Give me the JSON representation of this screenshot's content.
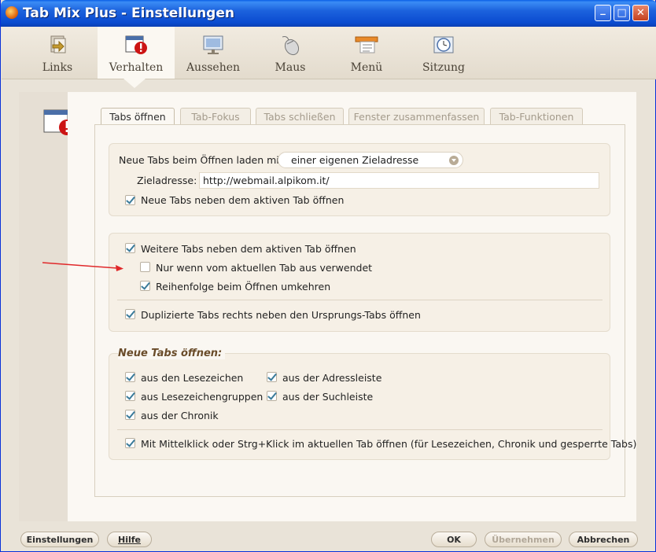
{
  "window": {
    "title": "Tab Mix Plus - Einstellungen"
  },
  "toolbar": {
    "items": [
      {
        "label": "Links",
        "icon": "links-icon"
      },
      {
        "label": "Verhalten",
        "icon": "behavior-icon",
        "active": true
      },
      {
        "label": "Aussehen",
        "icon": "appearance-icon"
      },
      {
        "label": "Maus",
        "icon": "mouse-icon"
      },
      {
        "label": "Menü",
        "icon": "menu-icon"
      },
      {
        "label": "Sitzung",
        "icon": "session-icon"
      }
    ]
  },
  "tabs": [
    "Tabs öffnen",
    "Tab-Fokus",
    "Tabs schließen",
    "Fenster zusammenfassen",
    "Tab-Funktionen"
  ],
  "group1": {
    "load_label": "Neue Tabs beim Öffnen laden mit",
    "load_value": "einer eigenen Zieladresse",
    "url_label": "Zieladresse:",
    "url_value": "http://webmail.alpikom.it/",
    "next_to_active": "Neue Tabs neben dem aktiven Tab öffnen"
  },
  "group2": {
    "further_tabs": "Weitere Tabs neben dem aktiven Tab öffnen",
    "only_if_used": "Nur wenn vom aktuellen Tab aus verwendet",
    "reverse_order": "Reihenfolge beim Öffnen umkehren",
    "duplicate_right": "Duplizierte Tabs rechts neben den Ursprungs-Tabs öffnen"
  },
  "group3": {
    "title": "Neue Tabs öffnen:",
    "from_bookmarks": "aus den Lesezeichen",
    "from_address_bar": "aus der Adressleiste",
    "from_bookmark_groups": "aus Lesezeichengruppen",
    "from_search_bar": "aus der Suchleiste",
    "from_history": "aus der Chronik",
    "middle_click": "Mit Mittelklick oder Strg+Klick im aktuellen Tab öffnen (für Lesezeichen, Chronik und gesperrte Tabs)"
  },
  "buttons": {
    "settings": "Einstellungen",
    "help": "Hilfe",
    "ok": "OK",
    "apply": "Übernehmen",
    "cancel": "Abbrechen"
  },
  "colors": {
    "accent": "#3b7b9a",
    "arrow": "#e0282a",
    "titlebar": "#0a4bd0"
  }
}
